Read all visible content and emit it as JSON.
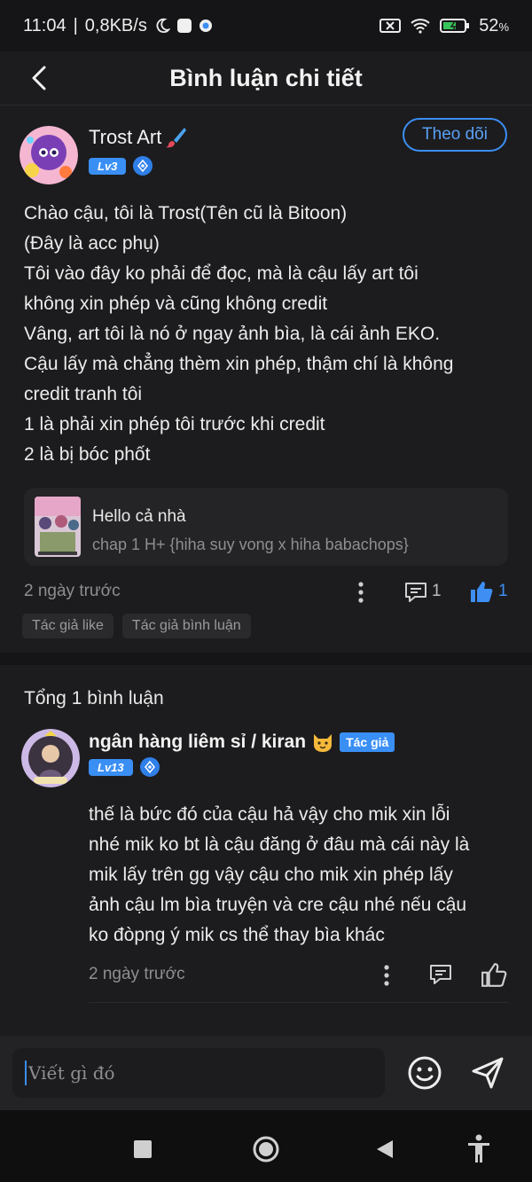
{
  "status_bar": {
    "time": "11:04",
    "separator": "|",
    "network_speed": "0,8KB/s",
    "battery": "52",
    "battery_unit": "%"
  },
  "header": {
    "title": "Bình luận chi tiết"
  },
  "post": {
    "author_name": "Trost Art",
    "level": "Lv3",
    "follow_label": "Theo dõi",
    "body_lines": [
      "Chào cậu, tôi là Trost(Tên cũ là Bitoon)",
      "(Đây là acc phụ)",
      "Tôi vào đây ko phải để đọc, mà là cậu lấy art tôi",
      "không xin phép và cũng không credit",
      "Vâng, art tôi là nó ở ngay ảnh bìa, là cái ảnh EKO.",
      "Cậu lấy mà chẳng thèm xin phép, thậm chí là không",
      "credit tranh tôi",
      "1 là phải xin phép tôi trước khi credit",
      "2 là bị bóc phốt"
    ],
    "story": {
      "title": "Hello cả nhà",
      "subtitle": "chap 1 H+ {hiha suy vong x hiha babachops}"
    },
    "time": "2 ngày trước",
    "comment_count": "1",
    "like_count": "1",
    "tags": [
      "Tác giả like",
      "Tác giả bình luận"
    ]
  },
  "comments": {
    "total_label": "Tổng 1 bình luận"
  },
  "reply": {
    "author_name": "ngân hàng liêm sỉ / kiran",
    "author_badge": "Tác giả",
    "level": "Lv13",
    "body_lines": [
      "thế là bức đó của cậu hả vậy cho mik xin lỗi",
      "nhé mik ko bt là cậu đăng ở đâu mà cái này là",
      "mik lấy trên gg vậy cậu cho mik xin phép lấy",
      "ảnh cậu lm bìa truyện và cre cậu nhé nếu cậu",
      "ko đòpng ý mik cs thể thay bìa khác"
    ],
    "time": "2 ngày trước"
  },
  "composer": {
    "placeholder": "Viết gì đó"
  },
  "colors": {
    "background": "#1c1c1e",
    "accent": "#3b8ef3",
    "muted_text": "#8e8e93"
  },
  "icons": {
    "back": "chevron-left-icon",
    "more": "more-vertical-icon",
    "comment": "comment-icon",
    "like": "thumbs-up-icon",
    "emoji": "smiley-icon",
    "send": "send-icon"
  }
}
